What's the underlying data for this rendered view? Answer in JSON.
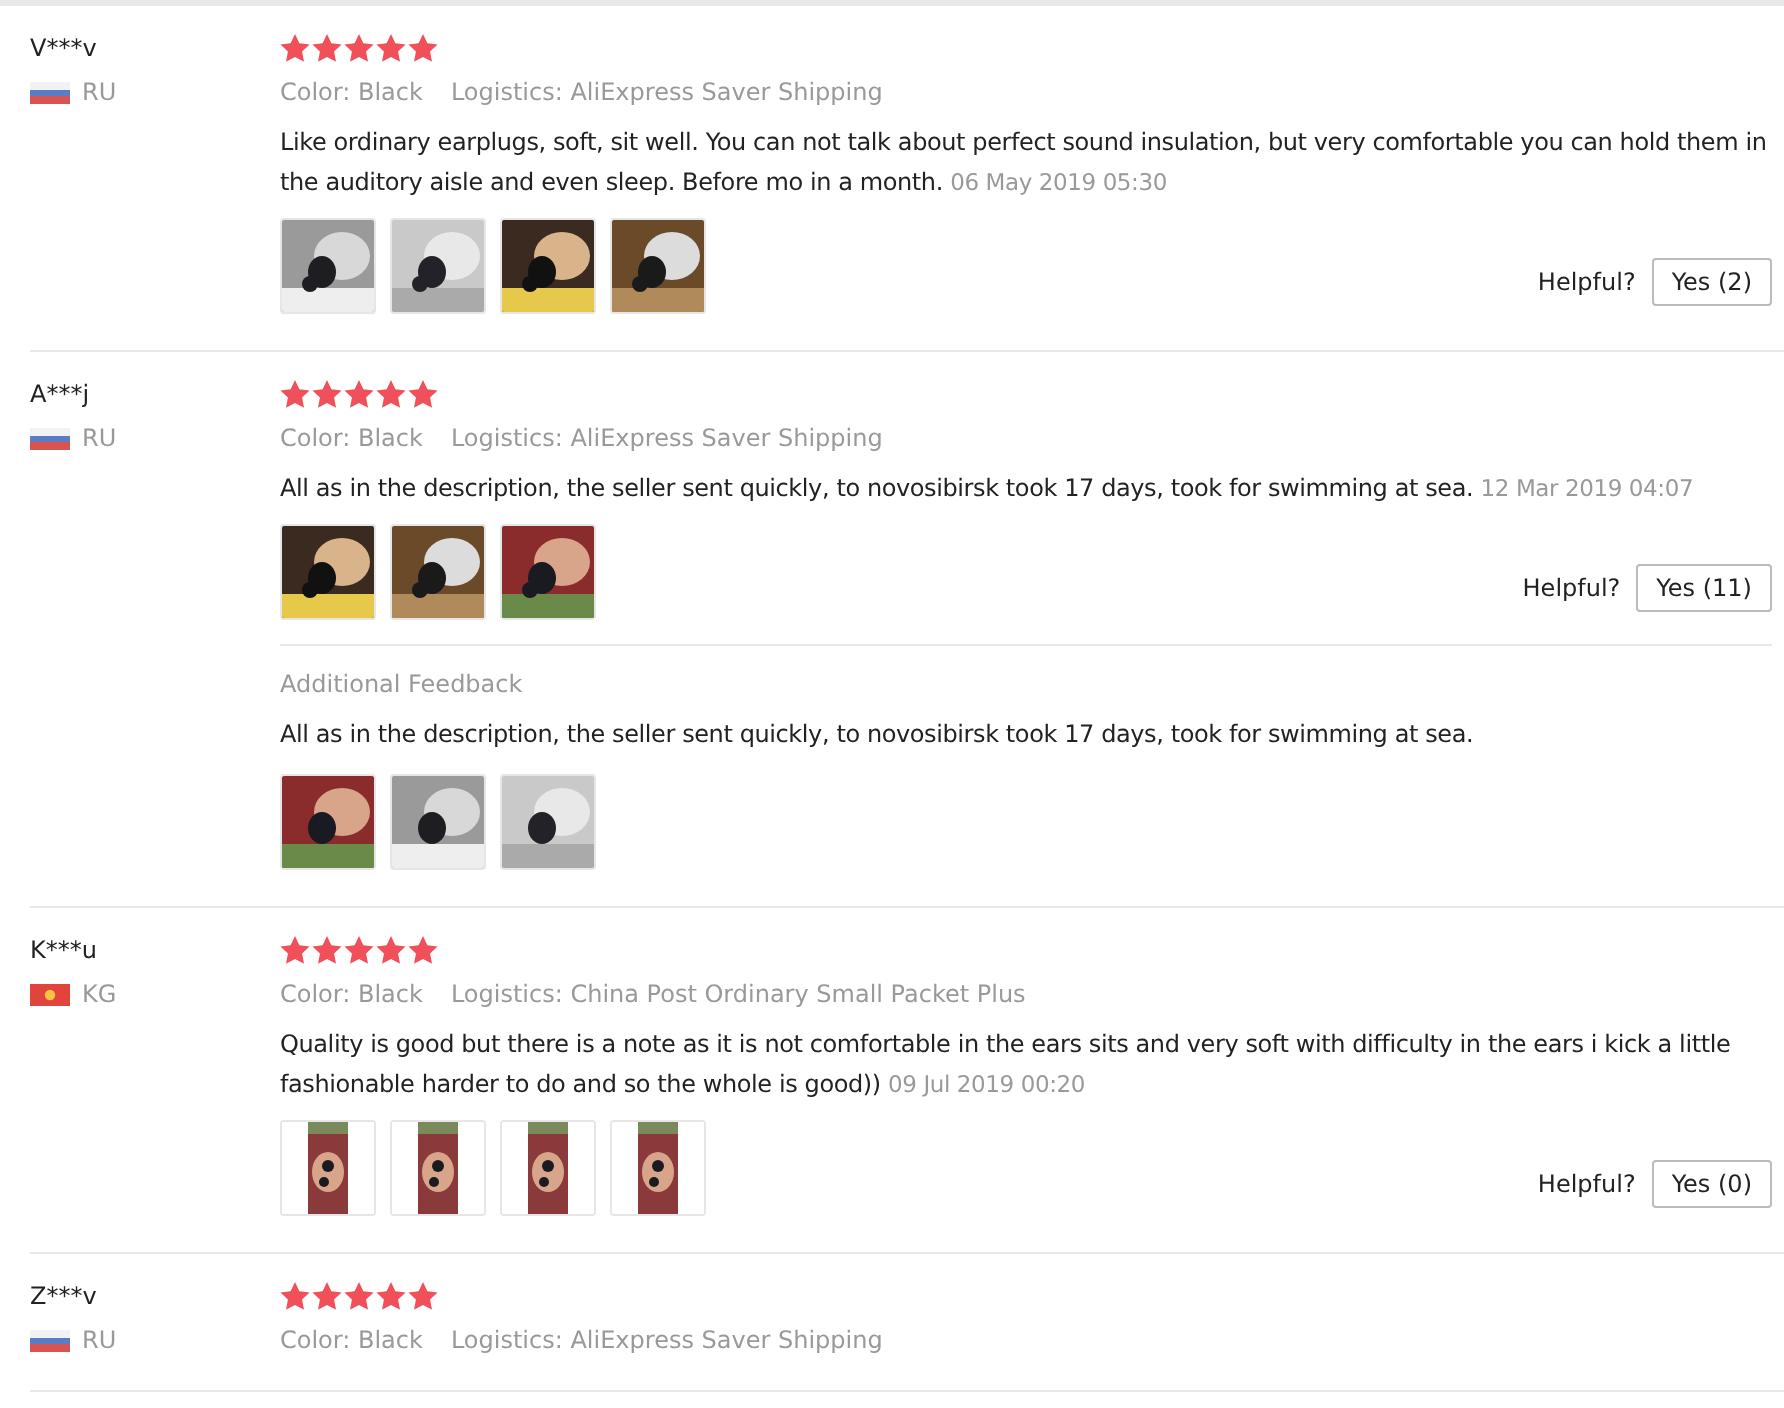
{
  "reviews": [
    {
      "user": "V***v",
      "flag": {
        "kind": "tricolor"
      },
      "country": "RU",
      "stars": 5,
      "variant": "Color: Black",
      "logistics": "Logistics: AliExpress Saver Shipping",
      "text": "Like ordinary earplugs, soft, sit well. You can not talk about perfect sound insulation, but very comfortable you can hold them in the auditory aisle and even sleep. Before mo in a month.",
      "date": "06 May 2019 05:30",
      "photos": [
        {
          "kind": "picture"
        },
        {
          "kind": "picture"
        },
        {
          "kind": "picture"
        },
        {
          "kind": "picture"
        }
      ],
      "helpful": {
        "label": "Helpful?",
        "button": "Yes (2)"
      }
    },
    {
      "user": "A***j",
      "flag": {
        "kind": "tricolor"
      },
      "country": "RU",
      "stars": 5,
      "variant": "Color: Black",
      "logistics": "Logistics: AliExpress Saver Shipping",
      "text": "All as in the description, the seller sent quickly, to novosibirsk took 17 days, took for swimming at sea.",
      "date": "12 Mar 2019 04:07",
      "photos": [
        {
          "kind": "picture"
        },
        {
          "kind": "picture"
        },
        {
          "kind": "picture"
        }
      ],
      "helpful": {
        "label": "Helpful?",
        "button": "Yes (11)"
      },
      "additional": {
        "label": "Additional Feedback",
        "text": "All as in the description, the seller sent quickly, to novosibirsk took 17 days, took for swimming at sea.",
        "photos": [
          {
            "kind": "picture"
          },
          {
            "kind": "picture"
          },
          {
            "kind": "picture"
          }
        ]
      }
    },
    {
      "user": "K***u",
      "flag": {
        "kind": "sun"
      },
      "country": "KG",
      "stars": 5,
      "variant": "Color: Black",
      "logistics": "Logistics: China Post Ordinary Small Packet Plus",
      "text": "Quality is good but there is a note as it is not comfortable in the ears sits and very soft with difficulty in the ears i kick a little fashionable harder to do and so the whole is good))",
      "date": "09 Jul 2019 00:20",
      "photos": [
        {
          "kind": "picture",
          "portrait": true
        },
        {
          "kind": "picture",
          "portrait": true
        },
        {
          "kind": "picture",
          "portrait": true
        },
        {
          "kind": "picture",
          "portrait": true
        }
      ],
      "helpful": {
        "label": "Helpful?",
        "button": "Yes (0)"
      }
    },
    {
      "user": "Z***v",
      "flag": {
        "kind": "tricolor"
      },
      "country": "RU",
      "stars": 5,
      "variant": "Color: Black",
      "logistics": "Logistics: AliExpress Saver Shipping"
    }
  ]
}
